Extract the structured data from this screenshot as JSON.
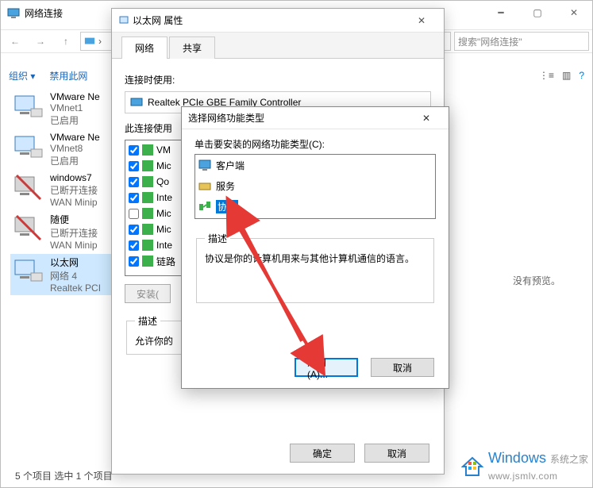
{
  "explorer": {
    "title": "网络连接",
    "search_placeholder": "搜索\"网络连接\"",
    "toolbar": {
      "organize": "组织 ▾",
      "disable": "禁用此网",
      "view_icon": "⋮≡",
      "help_icon": "?"
    },
    "items": [
      {
        "name": "VMware Ne",
        "sub": "VMnet1",
        "status": "已启用"
      },
      {
        "name": "VMware Ne",
        "sub": "VMnet8",
        "status": "已启用"
      },
      {
        "name": "windows7",
        "sub": "已断开连接",
        "status": "WAN Minip"
      },
      {
        "name": "随便",
        "sub": "已断开连接",
        "status": "WAN Minip"
      },
      {
        "name": "以太网",
        "sub": "网络 4",
        "status": "Realtek PCI"
      }
    ],
    "preview": "没有预览。",
    "status": "5 个项目    选中 1 个项目"
  },
  "dlg1": {
    "title": "以太网 属性",
    "tabs": [
      "网络",
      "共享"
    ],
    "connect_using": "连接时使用:",
    "adapter": "Realtek PCIe GBE Family Controller",
    "this_conn_uses": "此连接使用",
    "protocols": [
      {
        "checked": true,
        "label": "VM"
      },
      {
        "checked": true,
        "label": "Mic"
      },
      {
        "checked": true,
        "label": "Qo"
      },
      {
        "checked": true,
        "label": "Inte"
      },
      {
        "checked": false,
        "label": "Mic"
      },
      {
        "checked": true,
        "label": "Mic"
      },
      {
        "checked": true,
        "label": "Inte"
      },
      {
        "checked": true,
        "label": "链路"
      }
    ],
    "install_btn": "安装(",
    "desc_legend": "描述",
    "desc_text": "允许你的",
    "ok": "确定",
    "cancel": "取消"
  },
  "dlg2": {
    "title": "选择网络功能类型",
    "prompt": "单击要安装的网络功能类型(C):",
    "types": [
      {
        "label": "客户端",
        "selected": false
      },
      {
        "label": "服务",
        "selected": false
      },
      {
        "label": "协议",
        "selected": true
      }
    ],
    "desc_legend": "描述",
    "desc_text": "协议是你的计算机用来与其他计算机通信的语言。",
    "add": "添加(A)...",
    "cancel": "取消"
  },
  "watermark": {
    "brand": "Windows",
    "sub": "系统之家",
    "url": "www.jsmlv.com"
  }
}
